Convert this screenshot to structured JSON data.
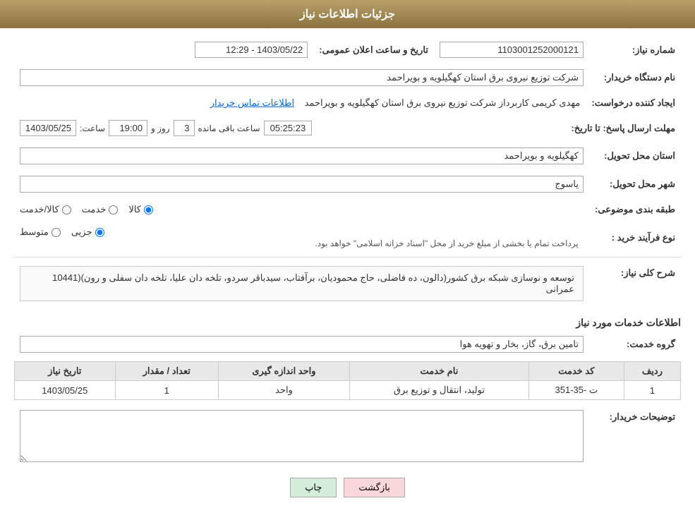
{
  "header": {
    "title": "جزئیات اطلاعات نیاز"
  },
  "fields": {
    "need_number_label": "شماره نیاز:",
    "need_number_value": "1103001252000121",
    "announce_date_label": "تاریخ و ساعت اعلان عمومی:",
    "announce_date_value": "1403/05/22 - 12:29",
    "buyer_org_label": "نام دستگاه خریدار:",
    "buyer_org_value": "شرکت توزیع نیروی برق استان کهگیلویه و بویراحمد",
    "creator_label": "ایجاد کننده درخواست:",
    "creator_value": "مهدی کریمی کاربرداز شرکت توزیع نیروی برق استان کهگیلویه و بویراحمد",
    "contact_link": "اطلاعات تماس خریدار",
    "deadline_label": "مهلت ارسال پاسخ: تا تاریخ:",
    "deadline_date": "1403/05/25",
    "deadline_time_label": "ساعت:",
    "deadline_time": "19:00",
    "deadline_day_label": "روز و",
    "deadline_day": "3",
    "countdown_label": "ساعت باقی مانده",
    "countdown_value": "05:25:23",
    "delivery_province_label": "استان محل تحویل:",
    "delivery_province_value": "کهگیلویه و بویراحمد",
    "delivery_city_label": "شهر محل تحویل:",
    "delivery_city_value": "یاسوج",
    "category_label": "طبقه بندی موضوعی:",
    "radio_kala": "کالا",
    "radio_khadamat": "خدمت",
    "radio_kala_khadamat": "کالا/خدمت",
    "purchase_type_label": "نوع فرآیند خرید :",
    "radio_jozvi": "جزیی",
    "radio_mottaset": "متوسط",
    "purchase_note": "پرداخت تمام یا بخشی از مبلغ خرید از محل \"اسناد خزانه اسلامی\" خواهد بود.",
    "narration_label": "شرح کلی نیاز:",
    "narration_value": "توسعه و نوسازی شبکه برق کشور(دالون، ده فاضلی، حاج محمودیان، برآفتاب، سیدباقر سردو، تلخه دان علیا، تلخه دان سفلی و رون)(10441  عمرانی",
    "services_title": "اطلاعات خدمات مورد نیاز",
    "service_group_label": "گروه خدمت:",
    "service_group_value": "تامین برق، گاز، بخار و تهویه هوا",
    "table_headers": {
      "row_num": "ردیف",
      "service_code": "کد خدمت",
      "service_name": "نام خدمت",
      "unit": "واحد اندازه گیری",
      "quantity": "تعداد / مقدار",
      "need_date": "تاریخ نیاز"
    },
    "table_rows": [
      {
        "row_num": "1",
        "service_code": "ت -35-351",
        "service_name": "تولید، انتقال و توزیع برق",
        "unit": "واحد",
        "quantity": "1",
        "need_date": "1403/05/25"
      }
    ],
    "buyer_desc_label": "توضیحات خریدار:",
    "buyer_desc_value": "",
    "btn_back": "بازگشت",
    "btn_print": "چاپ"
  }
}
